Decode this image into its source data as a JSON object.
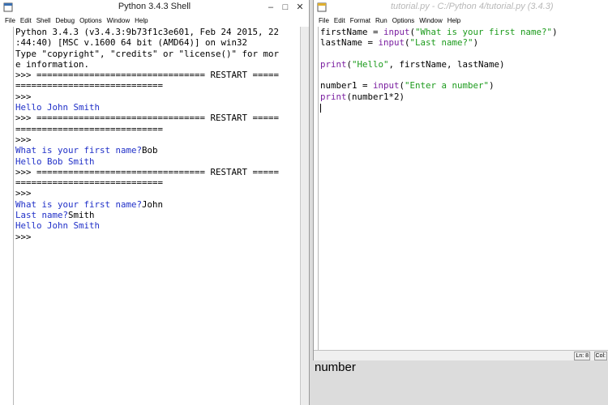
{
  "shell": {
    "title": "Python 3.4.3 Shell",
    "menu": [
      "File",
      "Edit",
      "Shell",
      "Debug",
      "Options",
      "Window",
      "Help"
    ],
    "lines": [
      {
        "t": "Python 3.4.3 (v3.4.3:9b73f1c3e601, Feb 24 2015, 22",
        "c": "blk"
      },
      {
        "t": ":44:40) [MSC v.1600 64 bit (AMD64)] on win32",
        "c": "blk"
      },
      {
        "t": "Type \"copyright\", \"credits\" or \"license()\" for mor",
        "c": "blk"
      },
      {
        "t": "e information.",
        "c": "blk"
      },
      {
        "t": ">>> ================================ RESTART =====",
        "c": "blk"
      },
      {
        "t": "============================",
        "c": "blk"
      },
      {
        "t": ">>>",
        "c": "blk"
      },
      {
        "t": "Hello John Smith",
        "c": "blue"
      },
      {
        "t": ">>> ================================ RESTART =====",
        "c": "blk"
      },
      {
        "t": "============================",
        "c": "blk"
      },
      {
        "t": ">>>",
        "c": "blk"
      },
      {
        "t": "What is your first name?",
        "c": "blue",
        "input": "Bob"
      },
      {
        "t": "Hello Bob Smith",
        "c": "blue"
      },
      {
        "t": ">>> ================================ RESTART =====",
        "c": "blk"
      },
      {
        "t": "============================",
        "c": "blk"
      },
      {
        "t": ">>>",
        "c": "blk"
      },
      {
        "t": "What is your first name?",
        "c": "blue",
        "input": "John"
      },
      {
        "t": "Last name?",
        "c": "blue",
        "input": "Smith"
      },
      {
        "t": "Hello John Smith",
        "c": "blue"
      },
      {
        "t": ">>>",
        "c": "blk"
      }
    ]
  },
  "editor": {
    "title": "tutorial.py - C:/Python 4/tutorial.py (3.4.3)",
    "menu": [
      "File",
      "Edit",
      "Format",
      "Run",
      "Options",
      "Window",
      "Help"
    ],
    "lines": [
      [
        {
          "t": "firstName = ",
          "c": "blk"
        },
        {
          "t": "input",
          "c": "purple"
        },
        {
          "t": "(",
          "c": "blk"
        },
        {
          "t": "\"What is your first name?\"",
          "c": "str"
        },
        {
          "t": ")",
          "c": "blk"
        }
      ],
      [
        {
          "t": "lastName = ",
          "c": "blk"
        },
        {
          "t": "input",
          "c": "purple"
        },
        {
          "t": "(",
          "c": "blk"
        },
        {
          "t": "\"Last name?\"",
          "c": "str"
        },
        {
          "t": ")",
          "c": "blk"
        }
      ],
      [],
      [
        {
          "t": "print",
          "c": "purple"
        },
        {
          "t": "(",
          "c": "blk"
        },
        {
          "t": "\"Hello\"",
          "c": "str"
        },
        {
          "t": ", firstName, lastName)",
          "c": "blk"
        }
      ],
      [],
      [
        {
          "t": "number1 = ",
          "c": "blk"
        },
        {
          "t": "input",
          "c": "purple"
        },
        {
          "t": "(",
          "c": "blk"
        },
        {
          "t": "\"Enter a number\"",
          "c": "str"
        },
        {
          "t": ")",
          "c": "blk"
        }
      ],
      [
        {
          "t": "print",
          "c": "purple"
        },
        {
          "t": "(number1*2)",
          "c": "blk"
        }
      ],
      []
    ],
    "status_ln": "Ln: 8",
    "status_col": "Col:"
  },
  "caption": "number"
}
